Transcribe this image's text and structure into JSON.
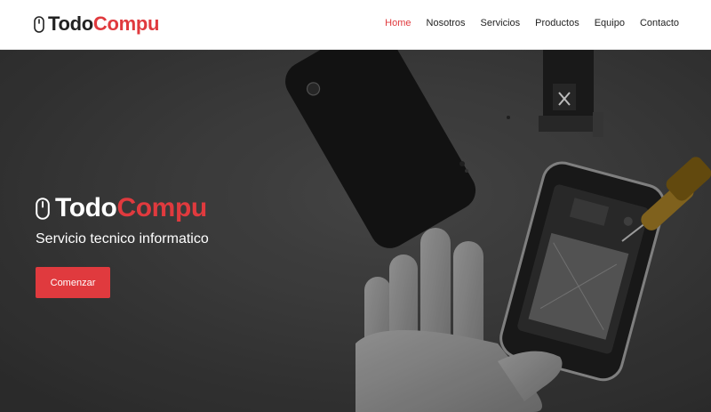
{
  "header": {
    "brand": {
      "part_a": "Todo",
      "part_b": "Compu",
      "icon": "mouse-icon"
    },
    "nav": [
      {
        "label": "Home",
        "active": true
      },
      {
        "label": "Nosotros",
        "active": false
      },
      {
        "label": "Servicios",
        "active": false
      },
      {
        "label": "Productos",
        "active": false
      },
      {
        "label": "Equipo",
        "active": false
      },
      {
        "label": "Contacto",
        "active": false
      }
    ]
  },
  "hero": {
    "brand": {
      "part_a": "Todo",
      "part_b": "Compu",
      "icon": "mouse-icon"
    },
    "subtitle": "Servicio tecnico informatico",
    "cta_label": "Comenzar"
  },
  "colors": {
    "accent": "#e03a3e",
    "hero_background": "#3b3b3b",
    "header_background": "#ffffff"
  }
}
